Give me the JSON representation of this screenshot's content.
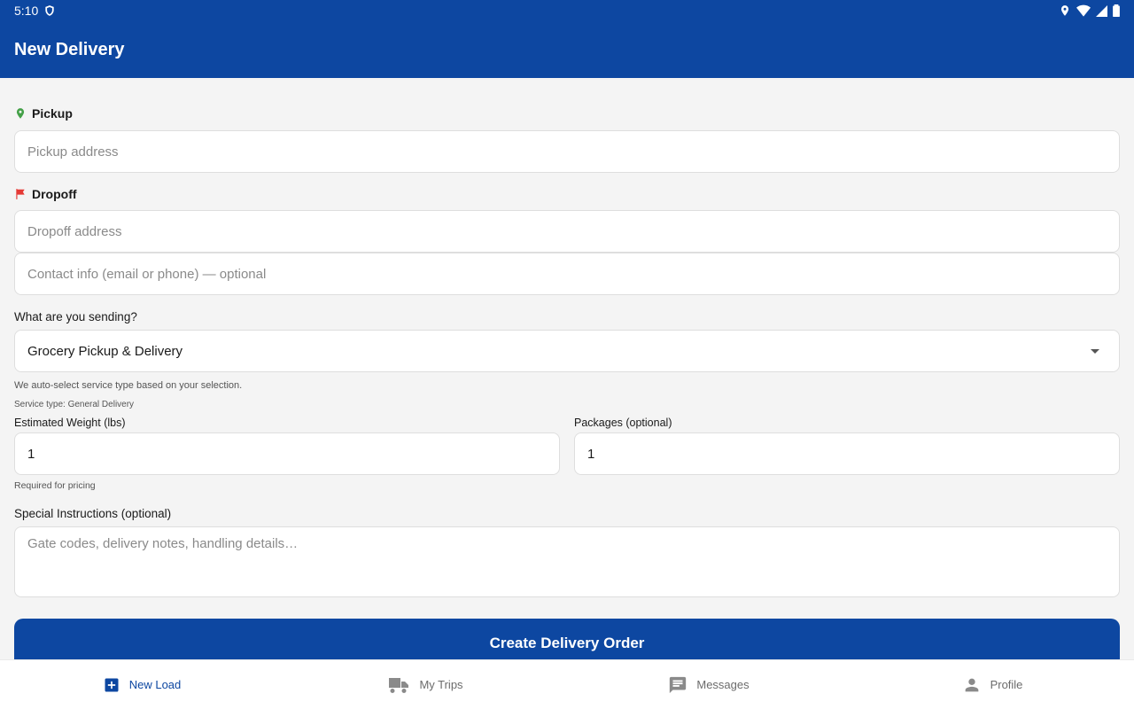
{
  "status_bar": {
    "time": "5:10"
  },
  "app_bar": {
    "title": "New Delivery"
  },
  "pickup": {
    "label": "Pickup",
    "placeholder": "Pickup address",
    "value": ""
  },
  "dropoff": {
    "label": "Dropoff",
    "placeholder": "Dropoff address",
    "value": "",
    "contact_placeholder": "Contact info (email or phone) — optional"
  },
  "sending": {
    "label": "What are you sending?",
    "selected": "Grocery Pickup & Delivery",
    "hint": "We auto-select service type based on your selection.",
    "service_type": "Service type: General Delivery"
  },
  "weight": {
    "label": "Estimated Weight (lbs)",
    "value": "1",
    "hint": "Required for pricing"
  },
  "packages": {
    "label": "Packages (optional)",
    "value": "1"
  },
  "instructions": {
    "label": "Special Instructions (optional)",
    "placeholder": "Gate codes, delivery notes, handling details…"
  },
  "submit": {
    "label": "Create Delivery Order"
  },
  "nav": {
    "items": [
      {
        "label": "New Load",
        "icon": "add-box-icon",
        "active": true
      },
      {
        "label": "My Trips",
        "icon": "truck-icon",
        "active": false
      },
      {
        "label": "Messages",
        "icon": "message-icon",
        "active": false
      },
      {
        "label": "Profile",
        "icon": "person-icon",
        "active": false
      }
    ]
  },
  "colors": {
    "primary": "#0d47a1",
    "pickup_pin": "#43a047",
    "dropoff_flag": "#e53935"
  }
}
